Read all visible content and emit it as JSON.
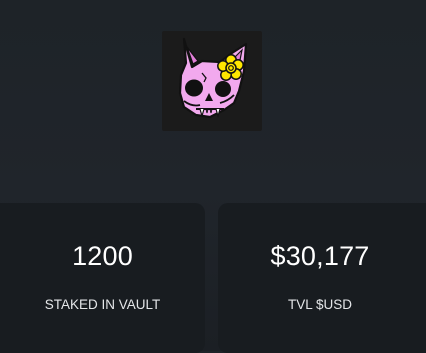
{
  "logo": {
    "icon": "pink-cat-skull-with-yellow-flower",
    "colors": {
      "skull": "#f2a9ee",
      "outline": "#111111",
      "flower": "#ffe600",
      "background": "#1b1b1b"
    }
  },
  "stats": [
    {
      "value": "1200",
      "label": "STAKED IN VAULT"
    },
    {
      "value": "$30,177",
      "label": "TVL $USD"
    }
  ]
}
